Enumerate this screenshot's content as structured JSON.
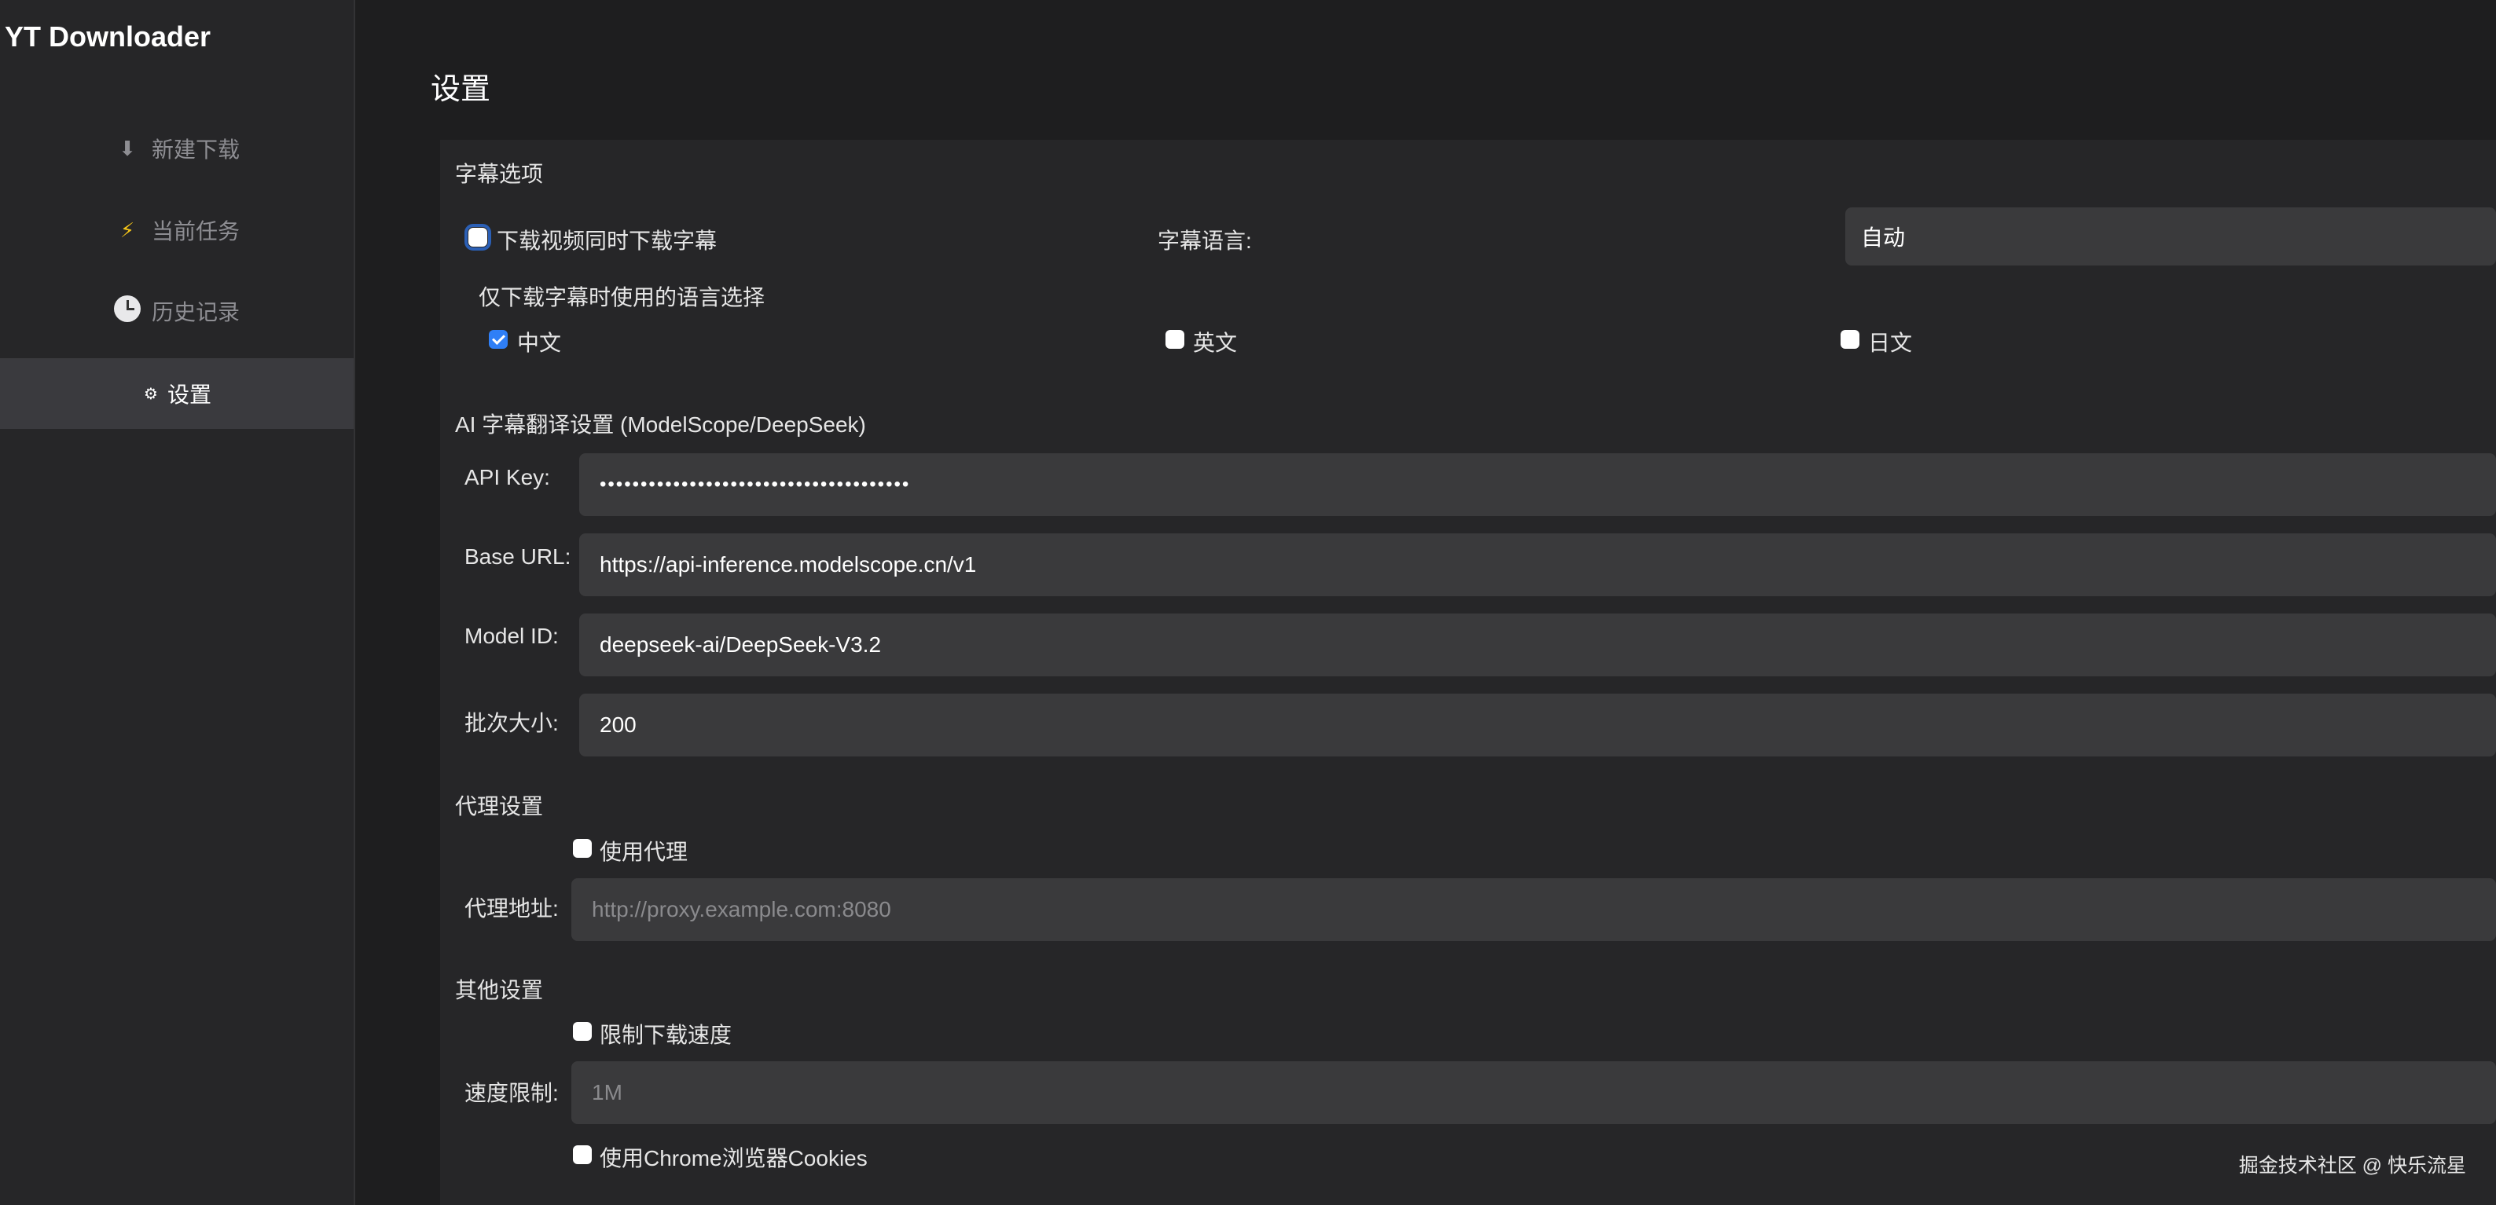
{
  "app": {
    "title": "YT Downloader"
  },
  "sidebar": {
    "items": [
      {
        "label": "新建下载",
        "icon": "download-icon",
        "active": false
      },
      {
        "label": "当前任务",
        "icon": "lightning-icon",
        "active": false
      },
      {
        "label": "历史记录",
        "icon": "clock-icon",
        "active": false
      },
      {
        "label": "设置",
        "icon": "gear-icon",
        "active": true
      }
    ]
  },
  "page": {
    "title": "设置"
  },
  "subtitles": {
    "section_title": "字幕选项",
    "download_with_video_label": "下载视频同时下载字幕",
    "download_with_video_checked": false,
    "language_label": "字幕语言:",
    "language_value": "自动",
    "only_subtitles_label": "仅下载字幕时使用的语言选择",
    "languages": [
      {
        "label": "中文",
        "checked": true
      },
      {
        "label": "英文",
        "checked": false
      },
      {
        "label": "日文",
        "checked": false
      }
    ]
  },
  "ai": {
    "section_title": "AI 字幕翻译设置 (ModelScope/DeepSeek)",
    "api_key_label": "API Key:",
    "api_key_value": "••••••••••••••••••••••••••••••••••••••",
    "base_url_label": "Base URL:",
    "base_url_value": "https://api-inference.modelscope.cn/v1",
    "model_id_label": "Model ID:",
    "model_id_value": "deepseek-ai/DeepSeek-V3.2",
    "batch_label": "批次大小:",
    "batch_value": "200"
  },
  "proxy": {
    "section_title": "代理设置",
    "use_proxy_label": "使用代理",
    "use_proxy_checked": false,
    "address_label": "代理地址:",
    "address_placeholder": "http://proxy.example.com:8080"
  },
  "other": {
    "section_title": "其他设置",
    "limit_speed_label": "限制下载速度",
    "limit_speed_checked": false,
    "speed_label": "速度限制:",
    "speed_placeholder": "1M",
    "chrome_cookies_label": "使用Chrome浏览器Cookies",
    "chrome_cookies_checked": false
  },
  "footer": {
    "watermark": "掘金技术社区 @ 快乐流星"
  },
  "colors": {
    "accent": "#2f7ff7",
    "background": "#1e1e1f",
    "panel": "#262628",
    "field": "#3a3a3c"
  }
}
